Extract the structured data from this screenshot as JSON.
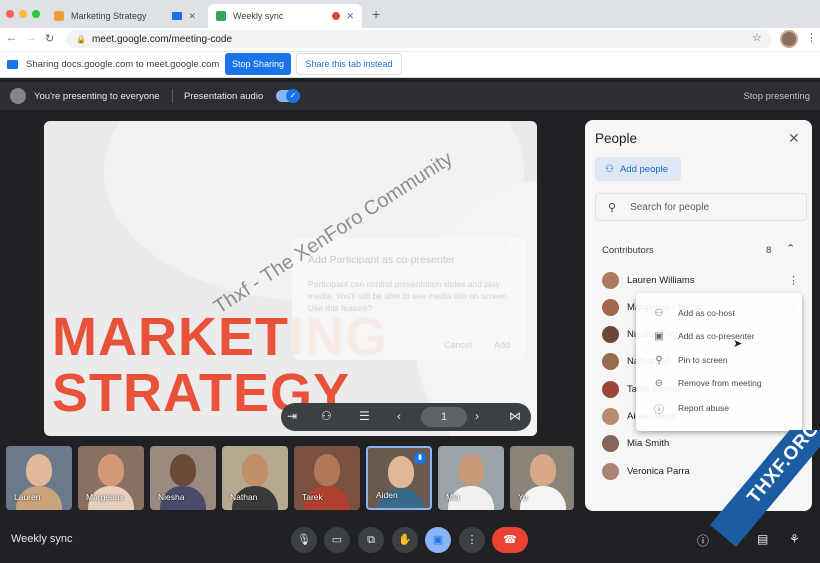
{
  "browser": {
    "tabs": [
      {
        "title": "Marketing Strategy",
        "favicon_color": "#f0a030"
      },
      {
        "title": "Weekly sync",
        "favicon_color": "#34a853"
      }
    ],
    "url": "meet.google.com/meeting-code"
  },
  "infobar": {
    "sharing_text": "Sharing docs.google.com to meet.google.com",
    "stop_sharing": "Stop Sharing",
    "share_this_tab": "Share this tab instead"
  },
  "presenting_bar": {
    "presenting_text": "You're presenting to everyone",
    "presentation_audio": "Presentation audio",
    "stop_presenting": "Stop presenting"
  },
  "slide": {
    "title_line1": "MARKETING",
    "title_line2": "STRATEGY",
    "dialog": {
      "title": "Add Participant as co-presenter",
      "body": "Participant can control presentation slides and play media. You'll still be able to see media title on screen. Use this feature?",
      "cancel": "Cancel",
      "add": "Add"
    },
    "page_number": "1"
  },
  "watermark": "Thxf - The XenForo Community",
  "filmstrip": [
    {
      "name": "Lauren",
      "bg": "#6b7a8a",
      "skin": "#e0b89a",
      "shirt": "#c9a47a"
    },
    {
      "name": "Margeaux",
      "bg": "#8a7060",
      "skin": "#d49a78",
      "shirt": "#e8d0c0"
    },
    {
      "name": "Niesha",
      "bg": "#9a8a80",
      "skin": "#6b4a38",
      "shirt": "#4a4a6a"
    },
    {
      "name": "Nathan",
      "bg": "#b8a890",
      "skin": "#c08e68",
      "shirt": "#3a3a3a"
    },
    {
      "name": "Tarek",
      "bg": "#7a5040",
      "skin": "#b07858",
      "shirt": "#b04030"
    },
    {
      "name": "Aiden",
      "bg": "#6a5a50",
      "skin": "#e0b898",
      "shirt": "#3a6a8a",
      "speaking": true
    },
    {
      "name": "Mia",
      "bg": "#9aa4a8",
      "skin": "#c89878",
      "shirt": "#f0f0f0"
    },
    {
      "name": "Yo",
      "bg": "#8a8478",
      "skin": "#d8a888",
      "shirt": "#f4f4f4"
    }
  ],
  "people_panel": {
    "title": "People",
    "add_people": "Add people",
    "search_placeholder": "Search for people",
    "section_label": "Contributors",
    "count": "8",
    "people": [
      {
        "name": "Lauren Williams",
        "color": "#b08060"
      },
      {
        "name": "Margeaux Phillips",
        "color": "#a86850"
      },
      {
        "name": "Niesha Thomas",
        "color": "#704838"
      },
      {
        "name": "Nathan Ali",
        "color": "#9a7050"
      },
      {
        "name": "Tarek Farouk",
        "color": "#a04838"
      },
      {
        "name": "Aiden Moss",
        "color": "#c09070"
      },
      {
        "name": "Mia Smith",
        "color": "#8a6a5a"
      },
      {
        "name": "Veronica Parra",
        "color": "#b08878"
      }
    ]
  },
  "context_menu": [
    {
      "label": "Add as co-host",
      "icon": "co-host-icon",
      "glyph": "⚇"
    },
    {
      "label": "Add as co-presenter",
      "icon": "co-presenter-icon",
      "glyph": "▣"
    },
    {
      "label": "Pin to screen",
      "icon": "pin-icon",
      "glyph": "⚲"
    },
    {
      "label": "Remove from meeting",
      "icon": "remove-icon",
      "glyph": "⊖"
    },
    {
      "label": "Report abuse",
      "icon": "info-icon",
      "glyph": "ⓘ"
    }
  ],
  "bottom_bar": {
    "meeting_name": "Weekly sync"
  },
  "badge": "THXF.ORG",
  "colors": {
    "accent": "#1a73e8",
    "slide_title": "#e8523a",
    "leave": "#ea4335"
  }
}
